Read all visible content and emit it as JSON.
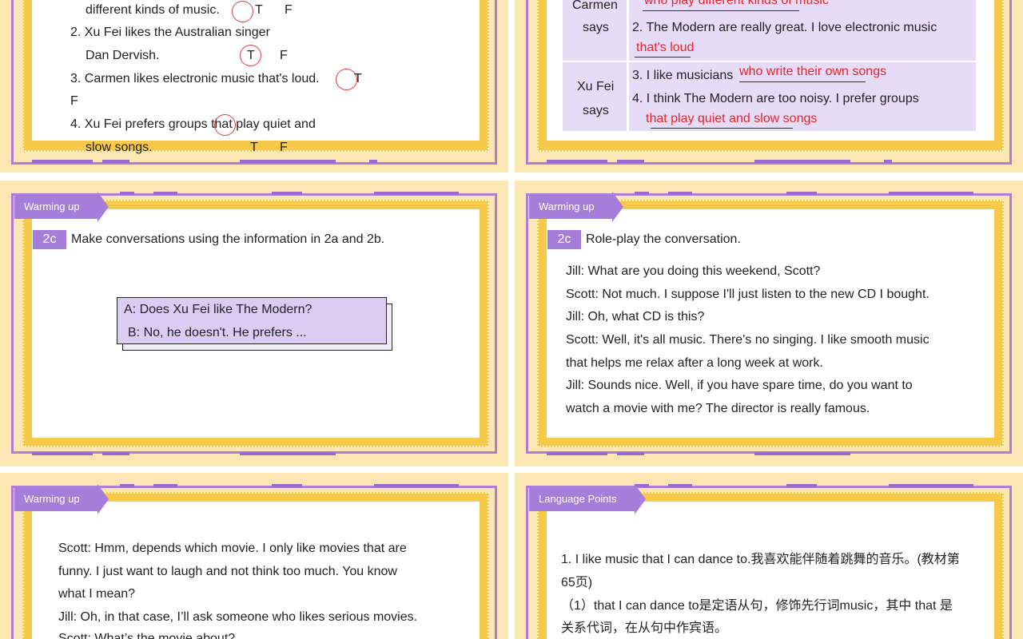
{
  "slide1": {
    "line1": "different kinds of music.",
    "line1_t": "T",
    "line1_f": "F",
    "item2a": "2. Xu Fei likes the Australian singer",
    "item2b": "Dan Dervish.",
    "item2_t": "T",
    "item2_f": "F",
    "item3": "3. Carmen likes electronic music that's loud.",
    "item3_t": "T",
    "item3_f": "F",
    "item4a": "4. Xu Fei prefers groups that play quiet and",
    "item4b": "slow songs.",
    "item4_t": "T",
    "item4_f": "F"
  },
  "slide2": {
    "carmen_label": "Carmen\nsays",
    "carmen_top": "Carmen",
    "carmen_says": "says",
    "answer1": "who play different kinds of music",
    "item2": "2. The Modern are really great. I love electronic music",
    "answer2": "that's loud",
    "xufei": "Xu Fei",
    "xufei_says": "says",
    "item3": "3. I like musicians",
    "answer3": "who write their own songs",
    "item4": "4. I think The Modern are too noisy. I prefer groups",
    "answer4": "that play quiet and slow songs"
  },
  "slide3": {
    "tag": "Warming up",
    "badge": "2c",
    "instruction": "Make conversations using the information in 2a and 2b.",
    "dialog_a": "A: Does Xu Fei like The Modern?",
    "dialog_b": "B: No, he doesn't. He prefers ..."
  },
  "slide4": {
    "tag": "Warming up",
    "badge": "2c",
    "instruction": "Role-play the conversation.",
    "lines": [
      "Jill: What are you doing this weekend, Scott?",
      "Scott: Not much. I suppose I'll just listen to the new CD I bought.",
      "Jill: Oh, what CD is this?",
      "Scott: Well, it's all music. There's no singing. I like smooth music",
      "that helps me relax after a long week at work.",
      "Jill: Sounds nice. Well, if you have spare time, do you want to",
      "watch a movie with me? The director is really famous."
    ]
  },
  "slide5": {
    "tag": "Warming up",
    "lines": [
      "Scott: Hmm, depends which movie. I only like movies that are",
      "funny. I just want to laugh and not think too much. You know",
      "what I mean?",
      "Jill: Oh, in that case, I’ll ask someone who likes serious movies.",
      "Scott: What’s the movie about?"
    ]
  },
  "slide6": {
    "tag": "Language Points",
    "lines": [
      "1. I like music that I can dance to.我喜欢能伴随着跳舞的音乐。(教材第",
      "65页)",
      "（1）that I can dance to是定语从句，修饰先行词music，其中 that 是",
      "关系代词，在从句中作宾语。"
    ]
  }
}
